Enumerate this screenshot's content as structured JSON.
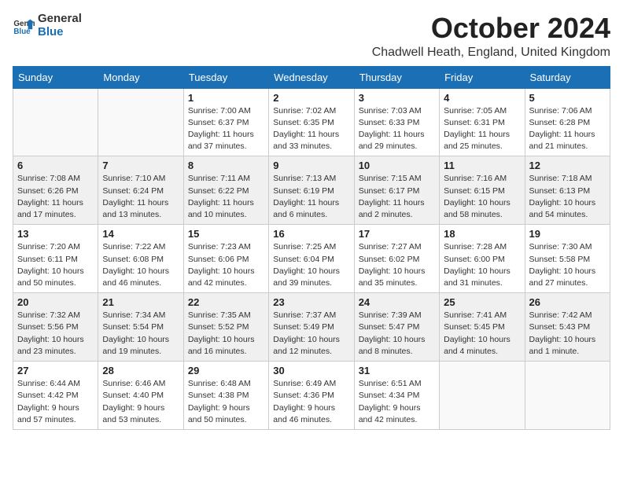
{
  "logo": {
    "line1": "General",
    "line2": "Blue"
  },
  "title": "October 2024",
  "location": "Chadwell Heath, England, United Kingdom",
  "days_of_week": [
    "Sunday",
    "Monday",
    "Tuesday",
    "Wednesday",
    "Thursday",
    "Friday",
    "Saturday"
  ],
  "weeks": [
    [
      {
        "day": "",
        "info": ""
      },
      {
        "day": "",
        "info": ""
      },
      {
        "day": "1",
        "info": "Sunrise: 7:00 AM\nSunset: 6:37 PM\nDaylight: 11 hours and 37 minutes."
      },
      {
        "day": "2",
        "info": "Sunrise: 7:02 AM\nSunset: 6:35 PM\nDaylight: 11 hours and 33 minutes."
      },
      {
        "day": "3",
        "info": "Sunrise: 7:03 AM\nSunset: 6:33 PM\nDaylight: 11 hours and 29 minutes."
      },
      {
        "day": "4",
        "info": "Sunrise: 7:05 AM\nSunset: 6:31 PM\nDaylight: 11 hours and 25 minutes."
      },
      {
        "day": "5",
        "info": "Sunrise: 7:06 AM\nSunset: 6:28 PM\nDaylight: 11 hours and 21 minutes."
      }
    ],
    [
      {
        "day": "6",
        "info": "Sunrise: 7:08 AM\nSunset: 6:26 PM\nDaylight: 11 hours and 17 minutes."
      },
      {
        "day": "7",
        "info": "Sunrise: 7:10 AM\nSunset: 6:24 PM\nDaylight: 11 hours and 13 minutes."
      },
      {
        "day": "8",
        "info": "Sunrise: 7:11 AM\nSunset: 6:22 PM\nDaylight: 11 hours and 10 minutes."
      },
      {
        "day": "9",
        "info": "Sunrise: 7:13 AM\nSunset: 6:19 PM\nDaylight: 11 hours and 6 minutes."
      },
      {
        "day": "10",
        "info": "Sunrise: 7:15 AM\nSunset: 6:17 PM\nDaylight: 11 hours and 2 minutes."
      },
      {
        "day": "11",
        "info": "Sunrise: 7:16 AM\nSunset: 6:15 PM\nDaylight: 10 hours and 58 minutes."
      },
      {
        "day": "12",
        "info": "Sunrise: 7:18 AM\nSunset: 6:13 PM\nDaylight: 10 hours and 54 minutes."
      }
    ],
    [
      {
        "day": "13",
        "info": "Sunrise: 7:20 AM\nSunset: 6:11 PM\nDaylight: 10 hours and 50 minutes."
      },
      {
        "day": "14",
        "info": "Sunrise: 7:22 AM\nSunset: 6:08 PM\nDaylight: 10 hours and 46 minutes."
      },
      {
        "day": "15",
        "info": "Sunrise: 7:23 AM\nSunset: 6:06 PM\nDaylight: 10 hours and 42 minutes."
      },
      {
        "day": "16",
        "info": "Sunrise: 7:25 AM\nSunset: 6:04 PM\nDaylight: 10 hours and 39 minutes."
      },
      {
        "day": "17",
        "info": "Sunrise: 7:27 AM\nSunset: 6:02 PM\nDaylight: 10 hours and 35 minutes."
      },
      {
        "day": "18",
        "info": "Sunrise: 7:28 AM\nSunset: 6:00 PM\nDaylight: 10 hours and 31 minutes."
      },
      {
        "day": "19",
        "info": "Sunrise: 7:30 AM\nSunset: 5:58 PM\nDaylight: 10 hours and 27 minutes."
      }
    ],
    [
      {
        "day": "20",
        "info": "Sunrise: 7:32 AM\nSunset: 5:56 PM\nDaylight: 10 hours and 23 minutes."
      },
      {
        "day": "21",
        "info": "Sunrise: 7:34 AM\nSunset: 5:54 PM\nDaylight: 10 hours and 19 minutes."
      },
      {
        "day": "22",
        "info": "Sunrise: 7:35 AM\nSunset: 5:52 PM\nDaylight: 10 hours and 16 minutes."
      },
      {
        "day": "23",
        "info": "Sunrise: 7:37 AM\nSunset: 5:49 PM\nDaylight: 10 hours and 12 minutes."
      },
      {
        "day": "24",
        "info": "Sunrise: 7:39 AM\nSunset: 5:47 PM\nDaylight: 10 hours and 8 minutes."
      },
      {
        "day": "25",
        "info": "Sunrise: 7:41 AM\nSunset: 5:45 PM\nDaylight: 10 hours and 4 minutes."
      },
      {
        "day": "26",
        "info": "Sunrise: 7:42 AM\nSunset: 5:43 PM\nDaylight: 10 hours and 1 minute."
      }
    ],
    [
      {
        "day": "27",
        "info": "Sunrise: 6:44 AM\nSunset: 4:42 PM\nDaylight: 9 hours and 57 minutes."
      },
      {
        "day": "28",
        "info": "Sunrise: 6:46 AM\nSunset: 4:40 PM\nDaylight: 9 hours and 53 minutes."
      },
      {
        "day": "29",
        "info": "Sunrise: 6:48 AM\nSunset: 4:38 PM\nDaylight: 9 hours and 50 minutes."
      },
      {
        "day": "30",
        "info": "Sunrise: 6:49 AM\nSunset: 4:36 PM\nDaylight: 9 hours and 46 minutes."
      },
      {
        "day": "31",
        "info": "Sunrise: 6:51 AM\nSunset: 4:34 PM\nDaylight: 9 hours and 42 minutes."
      },
      {
        "day": "",
        "info": ""
      },
      {
        "day": "",
        "info": ""
      }
    ]
  ]
}
